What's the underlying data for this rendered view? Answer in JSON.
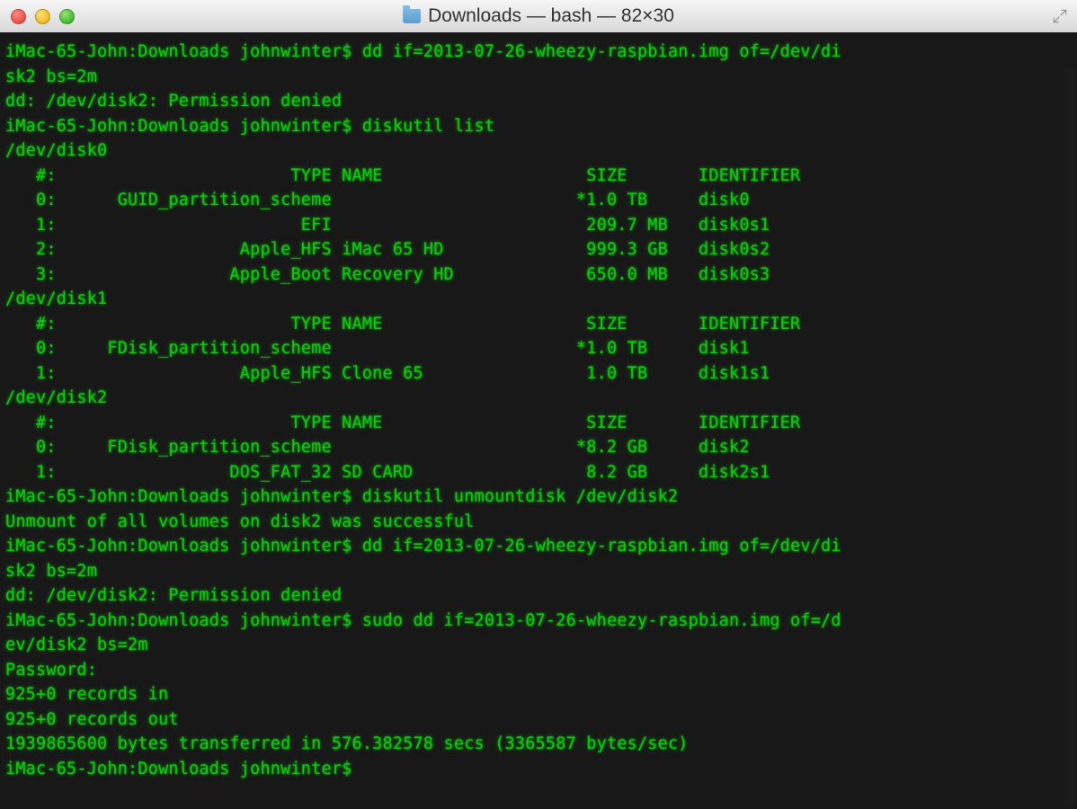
{
  "window": {
    "title": "Downloads — bash — 82×30"
  },
  "terminal": {
    "prompt": "iMac-65-John:Downloads johnwinter$",
    "lines": [
      "iMac-65-John:Downloads johnwinter$ dd if=2013-07-26-wheezy-raspbian.img of=/dev/di",
      "sk2 bs=2m",
      "dd: /dev/disk2: Permission denied",
      "iMac-65-John:Downloads johnwinter$ diskutil list",
      "/dev/disk0",
      "   #:                       TYPE NAME                    SIZE       IDENTIFIER",
      "   0:      GUID_partition_scheme                        *1.0 TB     disk0",
      "   1:                        EFI                         209.7 MB   disk0s1",
      "   2:                  Apple_HFS iMac 65 HD              999.3 GB   disk0s2",
      "   3:                 Apple_Boot Recovery HD             650.0 MB   disk0s3",
      "/dev/disk1",
      "   #:                       TYPE NAME                    SIZE       IDENTIFIER",
      "   0:     FDisk_partition_scheme                        *1.0 TB     disk1",
      "   1:                  Apple_HFS Clone 65                1.0 TB     disk1s1",
      "/dev/disk2",
      "   #:                       TYPE NAME                    SIZE       IDENTIFIER",
      "   0:     FDisk_partition_scheme                        *8.2 GB     disk2",
      "   1:                 DOS_FAT_32 SD CARD                 8.2 GB     disk2s1",
      "iMac-65-John:Downloads johnwinter$ diskutil unmountdisk /dev/disk2",
      "Unmount of all volumes on disk2 was successful",
      "iMac-65-John:Downloads johnwinter$ dd if=2013-07-26-wheezy-raspbian.img of=/dev/di",
      "sk2 bs=2m",
      "dd: /dev/disk2: Permission denied",
      "iMac-65-John:Downloads johnwinter$ sudo dd if=2013-07-26-wheezy-raspbian.img of=/d",
      "ev/disk2 bs=2m",
      "Password:",
      "925+0 records in",
      "925+0 records out",
      "1939865600 bytes transferred in 576.382578 secs (3365587 bytes/sec)",
      "iMac-65-John:Downloads johnwinter$ "
    ],
    "disks": [
      {
        "device": "/dev/disk0",
        "partitions": [
          {
            "num": "0",
            "type": "GUID_partition_scheme",
            "name": "",
            "size": "*1.0 TB",
            "identifier": "disk0"
          },
          {
            "num": "1",
            "type": "EFI",
            "name": "",
            "size": "209.7 MB",
            "identifier": "disk0s1"
          },
          {
            "num": "2",
            "type": "Apple_HFS",
            "name": "iMac 65 HD",
            "size": "999.3 GB",
            "identifier": "disk0s2"
          },
          {
            "num": "3",
            "type": "Apple_Boot",
            "name": "Recovery HD",
            "size": "650.0 MB",
            "identifier": "disk0s3"
          }
        ]
      },
      {
        "device": "/dev/disk1",
        "partitions": [
          {
            "num": "0",
            "type": "FDisk_partition_scheme",
            "name": "",
            "size": "*1.0 TB",
            "identifier": "disk1"
          },
          {
            "num": "1",
            "type": "Apple_HFS",
            "name": "Clone 65",
            "size": "1.0 TB",
            "identifier": "disk1s1"
          }
        ]
      },
      {
        "device": "/dev/disk2",
        "partitions": [
          {
            "num": "0",
            "type": "FDisk_partition_scheme",
            "name": "",
            "size": "*8.2 GB",
            "identifier": "disk2"
          },
          {
            "num": "1",
            "type": "DOS_FAT_32",
            "name": "SD CARD",
            "size": "8.2 GB",
            "identifier": "disk2s1"
          }
        ]
      }
    ],
    "commands": [
      "dd if=2013-07-26-wheezy-raspbian.img of=/dev/disk2 bs=2m",
      "diskutil list",
      "diskutil unmountdisk /dev/disk2",
      "dd if=2013-07-26-wheezy-raspbian.img of=/dev/disk2 bs=2m",
      "sudo dd if=2013-07-26-wheezy-raspbian.img of=/dev/disk2 bs=2m"
    ],
    "dd_result": {
      "records_in": "925+0",
      "records_out": "925+0",
      "bytes": "1939865600",
      "seconds": "576.382578",
      "rate": "3365587 bytes/sec"
    }
  }
}
